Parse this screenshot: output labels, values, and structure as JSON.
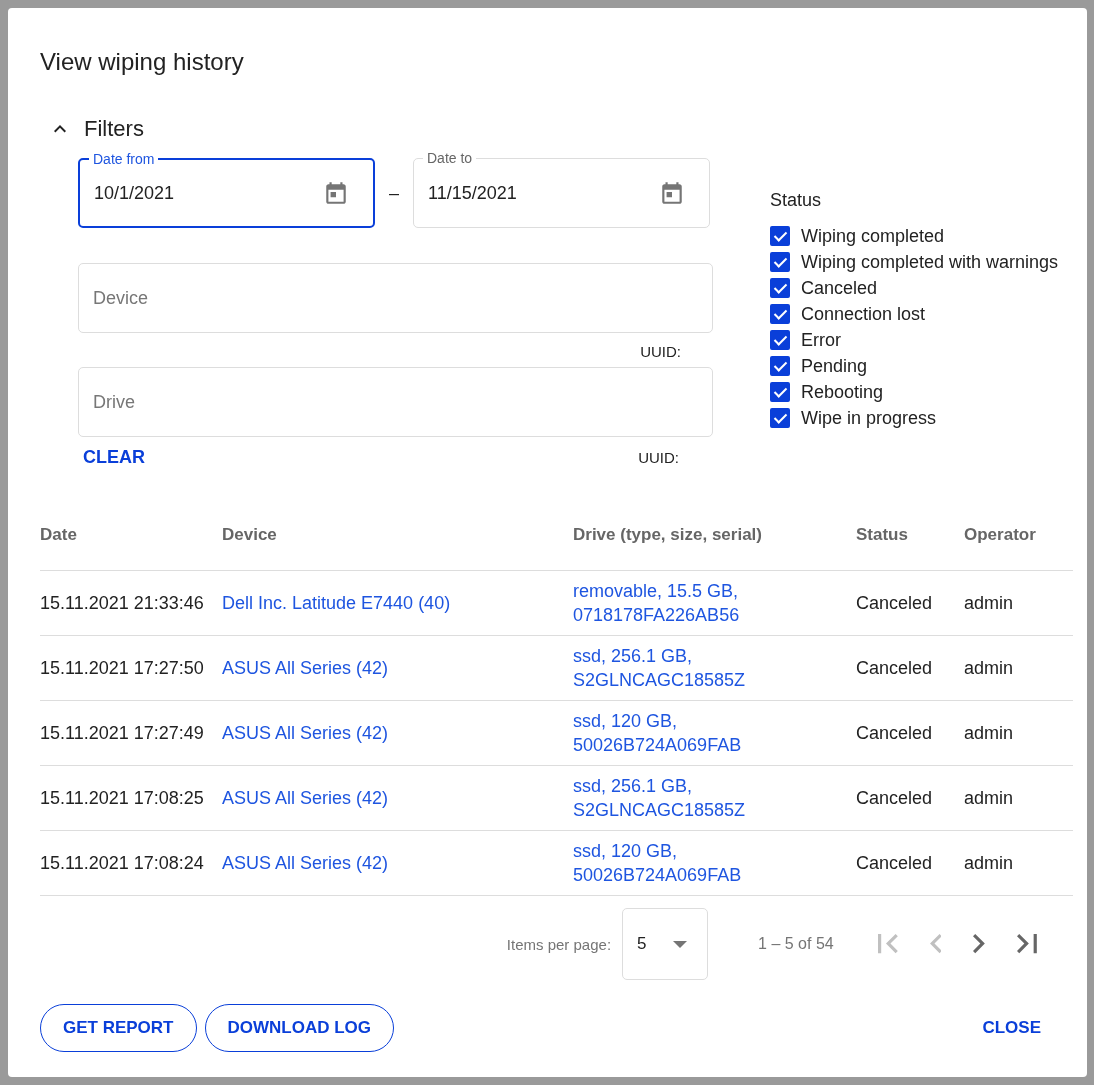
{
  "dialog": {
    "title": "View wiping history"
  },
  "filters": {
    "title": "Filters",
    "expanded": true,
    "date_from": {
      "label": "Date from",
      "value": "10/1/2021",
      "focused": true
    },
    "date_separator": "–",
    "date_to": {
      "label": "Date to",
      "value": "11/15/2021",
      "focused": false
    },
    "device": {
      "placeholder": "Device",
      "hint": "UUID:"
    },
    "drive": {
      "placeholder": "Drive",
      "hint": "UUID:"
    },
    "clear_button": "CLEAR",
    "status": {
      "title": "Status",
      "options": [
        {
          "label": "Wiping completed",
          "checked": true
        },
        {
          "label": "Wiping completed with warnings",
          "checked": true
        },
        {
          "label": "Canceled",
          "checked": true
        },
        {
          "label": "Connection lost",
          "checked": true
        },
        {
          "label": "Error",
          "checked": true
        },
        {
          "label": "Pending",
          "checked": true
        },
        {
          "label": "Rebooting",
          "checked": true
        },
        {
          "label": "Wipe in progress",
          "checked": true
        }
      ]
    }
  },
  "table": {
    "columns": [
      "Date",
      "Device",
      "Drive (type, size, serial)",
      "Status",
      "Operator"
    ],
    "rows": [
      {
        "date": "15.11.2021 21:33:46",
        "device": "Dell Inc. Latitude E7440 (40)",
        "drive": [
          "removable, 15.5 GB,",
          "0718178FA226AB56"
        ],
        "status": "Canceled",
        "operator": "admin"
      },
      {
        "date": "15.11.2021 17:27:50",
        "device": "ASUS All Series (42)",
        "drive": [
          "ssd, 256.1 GB,",
          "S2GLNCAGC18585Z"
        ],
        "status": "Canceled",
        "operator": "admin"
      },
      {
        "date": "15.11.2021 17:27:49",
        "device": "ASUS All Series (42)",
        "drive": [
          "ssd, 120 GB,",
          "50026B724A069FAB"
        ],
        "status": "Canceled",
        "operator": "admin"
      },
      {
        "date": "15.11.2021 17:08:25",
        "device": "ASUS All Series (42)",
        "drive": [
          "ssd, 256.1 GB,",
          "S2GLNCAGC18585Z"
        ],
        "status": "Canceled",
        "operator": "admin"
      },
      {
        "date": "15.11.2021 17:08:24",
        "device": "ASUS All Series (42)",
        "drive": [
          "ssd, 120 GB,",
          "50026B724A069FAB"
        ],
        "status": "Canceled",
        "operator": "admin"
      }
    ]
  },
  "paginator": {
    "items_per_page_label": "Items per page:",
    "page_size": "5",
    "range": "1 – 5 of 54",
    "buttons": [
      {
        "kind": "first",
        "disabled": true
      },
      {
        "kind": "previous",
        "disabled": true
      },
      {
        "kind": "next",
        "disabled": false
      },
      {
        "kind": "last",
        "disabled": false
      }
    ]
  },
  "actions": {
    "left": [
      "GET REPORT",
      "DOWNLOAD LOG"
    ],
    "close": "CLOSE"
  }
}
